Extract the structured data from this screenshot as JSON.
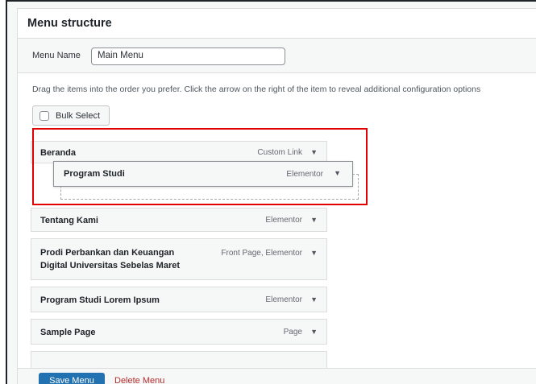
{
  "header": {
    "title": "Menu structure"
  },
  "menu_name": {
    "label": "Menu Name",
    "value": "Main Menu"
  },
  "instructions": "Drag the items into the order you prefer. Click the arrow on the right of the item to reveal additional configuration options",
  "bulk_select": {
    "label": "Bulk Select"
  },
  "items": [
    {
      "title": "Beranda",
      "type": "Custom Link"
    },
    {
      "title": "Tentang Kami",
      "type": "Elementor"
    },
    {
      "title": "Prodi Perbankan dan Keuangan Digital Universitas Sebelas Maret",
      "title_line1": "Prodi Perbankan dan Keuangan",
      "title_line2": "Digital Universitas Sebelas Maret",
      "type": "Front Page, Elementor"
    },
    {
      "title": "Program Studi Lorem Ipsum",
      "type": "Elementor"
    },
    {
      "title": "Sample Page",
      "type": "Page"
    }
  ],
  "dragging_item": {
    "title": "Program Studi",
    "type": "Elementor"
  },
  "footer": {
    "save_label": "Save Menu",
    "delete_label": "Delete Menu"
  },
  "icons": {
    "expand_arrow": "triangle-down-icon"
  },
  "colors": {
    "primary_button": "#2271b1",
    "delete_link": "#b32d2e",
    "highlight_border": "#e00000"
  }
}
